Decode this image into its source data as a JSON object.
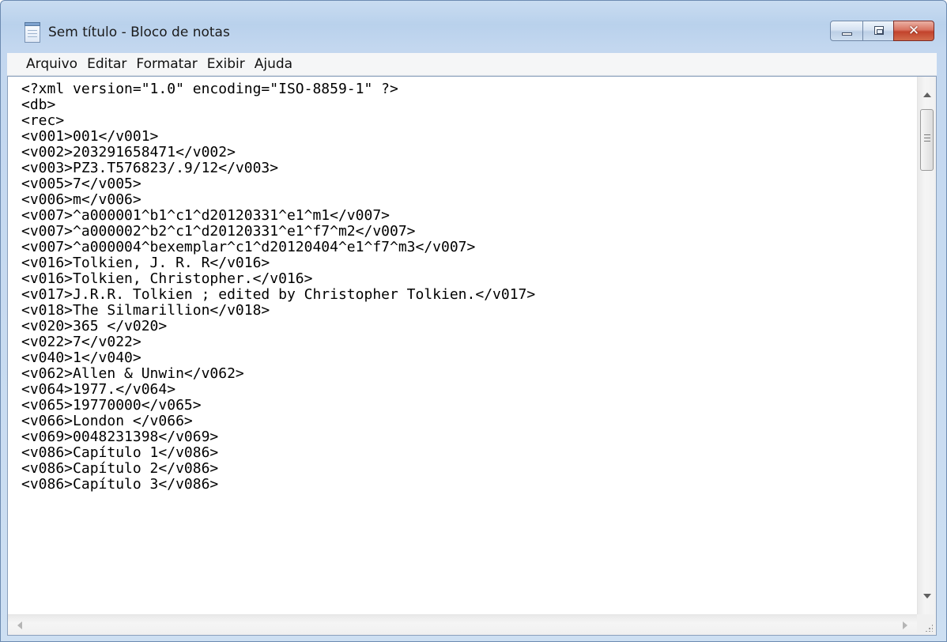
{
  "window": {
    "title": "Sem título - Bloco de notas",
    "icon": "notepad-icon",
    "controls": {
      "minimize_icon": "minimize-icon",
      "maximize_icon": "maximize-icon",
      "close_label": "✕"
    }
  },
  "menu": {
    "items": [
      "Arquivo",
      "Editar",
      "Formatar",
      "Exibir",
      "Ajuda"
    ]
  },
  "editor": {
    "lines": [
      "<?xml version=\"1.0\" encoding=\"ISO-8859-1\" ?>",
      "<db>",
      "<rec>",
      "<v001>001</v001>",
      "<v002>203291658471</v002>",
      "<v003>PZ3.T576823/.9/12</v003>",
      "<v005>7</v005>",
      "<v006>m</v006>",
      "<v007>^a000001^b1^c1^d20120331^e1^m1</v007>",
      "<v007>^a000002^b2^c1^d20120331^e1^f7^m2</v007>",
      "<v007>^a000004^bexemplar^c1^d20120404^e1^f7^m3</v007>",
      "<v016>Tolkien, J. R. R</v016>",
      "<v016>Tolkien, Christopher.</v016>",
      "<v017>J.R.R. Tolkien ; edited by Christopher Tolkien.</v017>",
      "<v018>The Silmarillion</v018>",
      "<v020>365 </v020>",
      "<v022>7</v022>",
      "<v040>1</v040>",
      "<v062>Allen & Unwin</v062>",
      "<v064>1977.</v064>",
      "<v065>19770000</v065>",
      "<v066>London </v066>",
      "<v069>0048231398</v069>",
      "<v086>Capítulo 1</v086>",
      "<v086>Capítulo 2</v086>",
      "<v086>Capítulo 3</v086>"
    ]
  },
  "colors": {
    "title_bar": "#b9d1ec",
    "close_button": "#c2432c",
    "menubar": "#f5f6f7",
    "editor_bg": "#ffffff"
  }
}
